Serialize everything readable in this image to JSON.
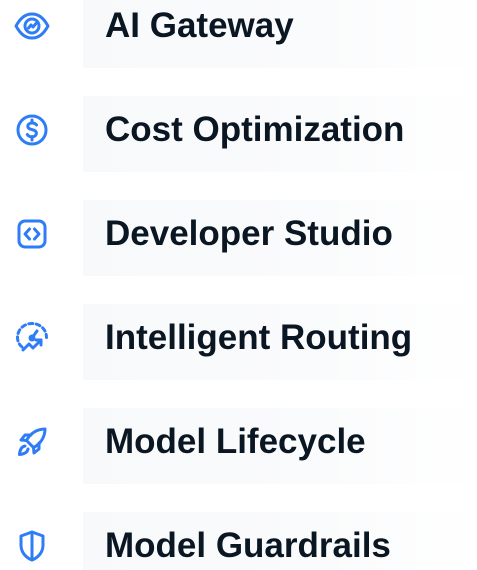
{
  "accent_color": "#2f7df6",
  "items": [
    {
      "label": "AI Gateway",
      "icon": "eye-icon"
    },
    {
      "label": "Cost Optimization",
      "icon": "dollar-circle-icon"
    },
    {
      "label": "Developer Studio",
      "icon": "code-icon"
    },
    {
      "label": "Intelligent Routing",
      "icon": "speedometer-trend-icon"
    },
    {
      "label": "Model Lifecycle",
      "icon": "rocket-icon"
    },
    {
      "label": "Model Guardrails",
      "icon": "shield-icon"
    }
  ]
}
